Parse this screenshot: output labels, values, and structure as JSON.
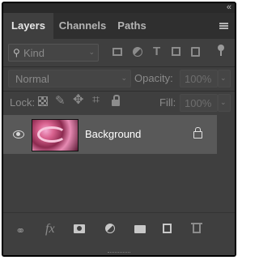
{
  "panel": {
    "collapse_glyph": "«",
    "tabs": [
      {
        "label": "Layers",
        "active": true
      },
      {
        "label": "Channels",
        "active": false
      },
      {
        "label": "Paths",
        "active": false
      }
    ]
  },
  "filter": {
    "placeholder": "Kind",
    "icons": [
      "image-filter-icon",
      "adjustment-filter-icon",
      "type-filter-icon",
      "shape-filter-icon",
      "smart-object-filter-icon",
      "filter-toggle-icon"
    ]
  },
  "blend": {
    "mode": "Normal",
    "opacity_label": "Opacity:",
    "opacity_value": "100%"
  },
  "locks": {
    "label": "Lock:",
    "fill_label": "Fill:",
    "fill_value": "100%"
  },
  "layers": [
    {
      "name": "Background",
      "visible": true,
      "locked": true
    }
  ],
  "footer": {
    "fx_label": "fx"
  }
}
